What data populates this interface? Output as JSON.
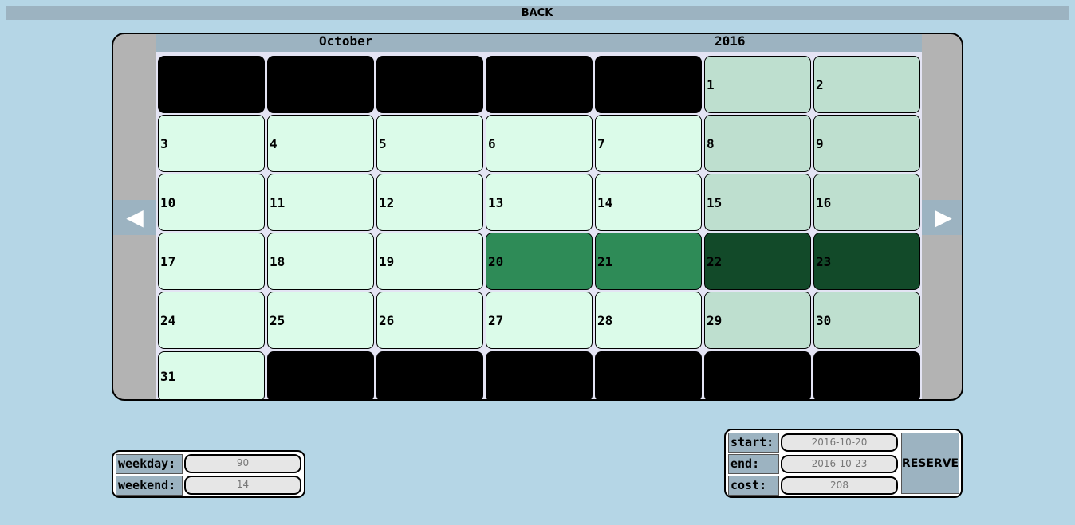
{
  "header": {
    "back_label": "BACK"
  },
  "calendar": {
    "month": "October",
    "year": "2016",
    "prev_icon": "◀",
    "next_icon": "▶",
    "weeks": [
      [
        null,
        null,
        null,
        null,
        null,
        "1",
        "2"
      ],
      [
        "3",
        "4",
        "5",
        "6",
        "7",
        "8",
        "9"
      ],
      [
        "10",
        "11",
        "12",
        "13",
        "14",
        "15",
        "16"
      ],
      [
        "17",
        "18",
        "19",
        "20",
        "21",
        "22",
        "23"
      ],
      [
        "24",
        "25",
        "26",
        "27",
        "28",
        "29",
        "30"
      ],
      [
        "31",
        null,
        null,
        null,
        null,
        null,
        null
      ]
    ],
    "selected_days": [
      "20",
      "21",
      "22",
      "23"
    ]
  },
  "rates": {
    "weekday_label": "weekday:",
    "weekday_value": "90",
    "weekend_label": "weekend:",
    "weekend_value": "14"
  },
  "reservation": {
    "start_label": "start:",
    "start_value": "2016-10-20",
    "end_label": "end:",
    "end_value": "2016-10-23",
    "cost_label": "cost:",
    "cost_value": "208",
    "reserve_label": "RESERVE"
  },
  "colors": {
    "background": "#b5d6e6",
    "bar": "#9cb3c1",
    "weekday": "#dbfbe9",
    "weekend": "#bedfcf",
    "selected_weekday": "#2e8b57",
    "selected_weekend": "#124a29"
  }
}
